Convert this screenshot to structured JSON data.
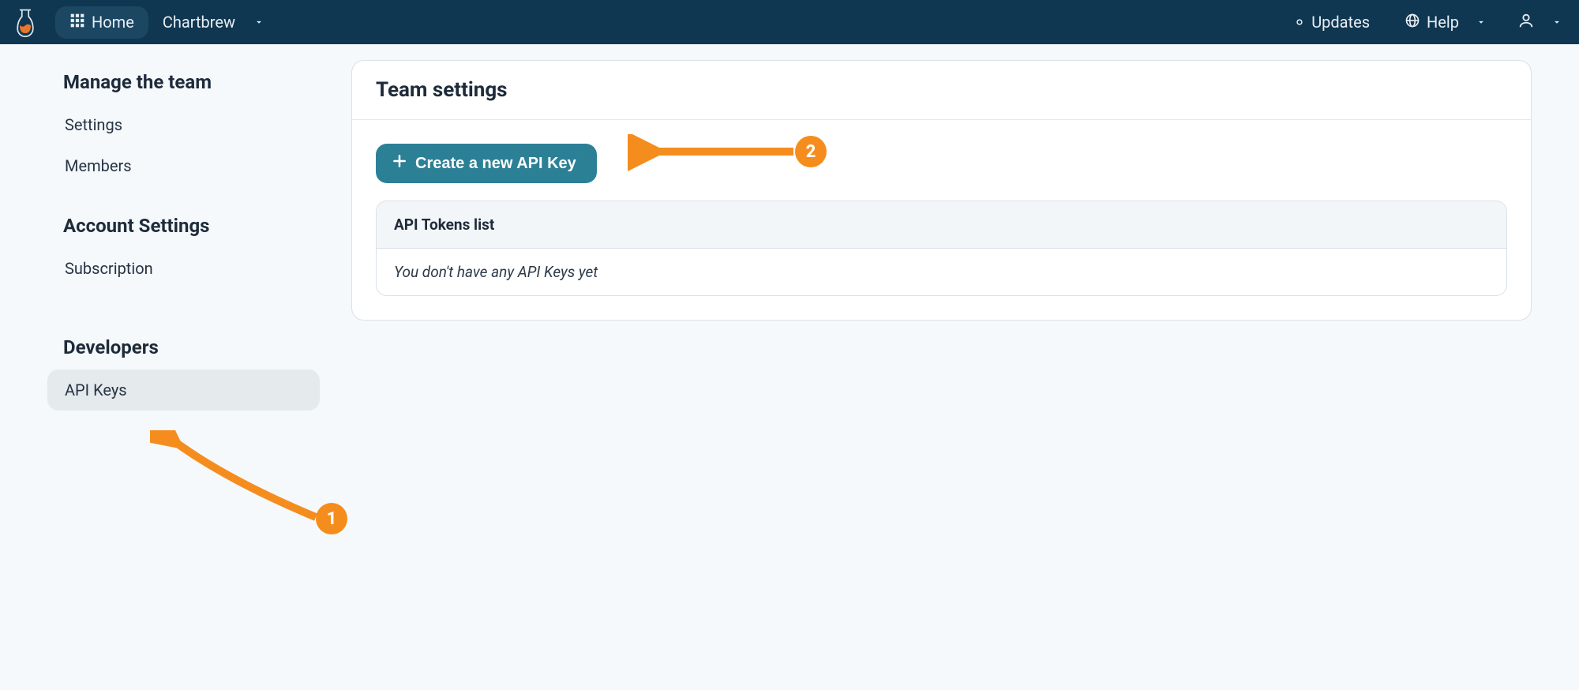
{
  "navbar": {
    "home_label": "Home",
    "brand_label": "Chartbrew",
    "updates_label": "Updates",
    "help_label": "Help"
  },
  "sidebar": {
    "section1_title": "Manage the team",
    "section1_items": [
      "Settings",
      "Members"
    ],
    "section2_title": "Account Settings",
    "section2_items": [
      "Subscription"
    ],
    "section3_title": "Developers",
    "section3_items": [
      "API Keys"
    ]
  },
  "content": {
    "panel_title": "Team settings",
    "create_btn_label": "Create a new API Key",
    "list_header": "API Tokens list",
    "empty_text": "You don't have any API Keys yet"
  },
  "annotations": {
    "badge1": "1",
    "badge2": "2"
  }
}
